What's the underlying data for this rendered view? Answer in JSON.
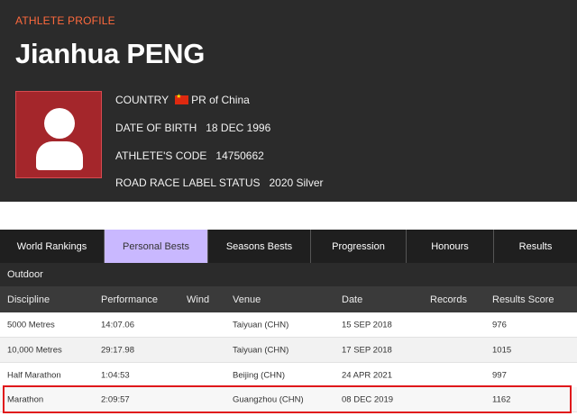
{
  "profile": {
    "kicker": "ATHLETE PROFILE",
    "name": "Jianhua PENG",
    "country_label": "COUNTRY",
    "country_value": "PR of China",
    "dob_label": "DATE OF BIRTH",
    "dob_value": "18 DEC 1996",
    "code_label": "ATHLETE'S CODE",
    "code_value": "14750662",
    "label_status_label": "ROAD RACE LABEL STATUS",
    "label_status_value": "2020 Silver",
    "colors": {
      "header_bg": "#2b2b2b",
      "kicker": "#ff6a3d",
      "avatar_bg": "#a4262b"
    }
  },
  "tabs": [
    {
      "label": "World Rankings",
      "active": false
    },
    {
      "label": "Personal Bests",
      "active": true
    },
    {
      "label": "Seasons Bests",
      "active": false
    },
    {
      "label": "Progression",
      "active": false
    },
    {
      "label": "Honours",
      "active": false
    },
    {
      "label": "Results",
      "active": false
    }
  ],
  "section_title": "Outdoor",
  "table": {
    "headers": {
      "discipline": "Discipline",
      "performance": "Performance",
      "wind": "Wind",
      "venue": "Venue",
      "date": "Date",
      "records": "Records",
      "score": "Results Score"
    },
    "rows": [
      {
        "discipline": "5000 Metres",
        "performance": "14:07.06",
        "wind": "",
        "venue": "Taiyuan (CHN)",
        "date": "15 SEP 2018",
        "records": "",
        "score": "976"
      },
      {
        "discipline": "10,000 Metres",
        "performance": "29:17.98",
        "wind": "",
        "venue": "Taiyuan (CHN)",
        "date": "17 SEP 2018",
        "records": "",
        "score": "1015"
      },
      {
        "discipline": "Half Marathon",
        "performance": "1:04:53",
        "wind": "",
        "venue": "Beijing (CHN)",
        "date": "24 APR 2021",
        "records": "",
        "score": "997"
      },
      {
        "discipline": "Marathon",
        "performance": "2:09:57",
        "wind": "",
        "venue": "Guangzhou (CHN)",
        "date": "08 DEC 2019",
        "records": "",
        "score": "1162"
      }
    ],
    "highlighted_row": "Marathon",
    "colors": {
      "active_tab": "#c9b8ff",
      "highlight_border": "#e0181b"
    }
  }
}
